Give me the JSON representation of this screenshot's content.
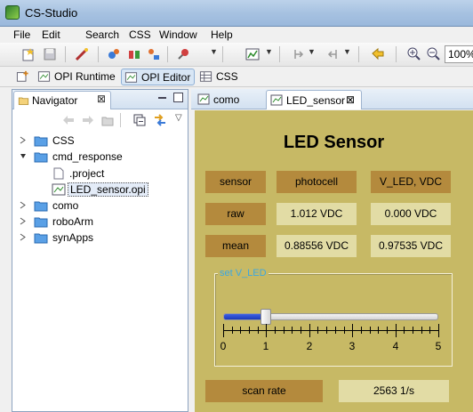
{
  "window": {
    "title": "CS-Studio"
  },
  "menu": [
    "File",
    "Edit",
    "Search",
    "CSS",
    "Window",
    "Help"
  ],
  "toolbar": {
    "zoom": "100%"
  },
  "perspectives": {
    "runtime": "OPI Runtime",
    "editor": "OPI Editor",
    "css": "CSS"
  },
  "navigator": {
    "tab_label": "Navigator",
    "close_glyph": "⊠",
    "tree": [
      {
        "label": "CSS",
        "type": "folder",
        "expanded": false,
        "depth": 0
      },
      {
        "label": "cmd_response",
        "type": "folder",
        "expanded": true,
        "depth": 0
      },
      {
        "label": ".project",
        "type": "file",
        "depth": 1
      },
      {
        "label": "LED_sensor.opi",
        "type": "opi",
        "depth": 1,
        "selected": true
      },
      {
        "label": "como",
        "type": "folder",
        "expanded": false,
        "depth": 0
      },
      {
        "label": "roboArm",
        "type": "folder",
        "expanded": false,
        "depth": 0
      },
      {
        "label": "synApps",
        "type": "folder",
        "expanded": false,
        "depth": 0
      }
    ]
  },
  "editor": {
    "tabs": [
      {
        "label": "como",
        "active": false
      },
      {
        "label": "LED_sensor",
        "active": true,
        "close": "⊠"
      }
    ],
    "opi": {
      "title": "LED Sensor",
      "header": {
        "c1": "sensor",
        "c2": "photocell",
        "c3": "V_LED, VDC"
      },
      "raw": {
        "label": "raw",
        "photocell": "1.012 VDC",
        "vled": "0.000 VDC"
      },
      "mean": {
        "label": "mean",
        "photocell": "0.88556 VDC",
        "vled": "0.97535 VDC"
      },
      "slider": {
        "group_title": "set V_LED",
        "value": 1.0,
        "min": 0,
        "max": 5,
        "tick_labels": [
          "0",
          "1",
          "2",
          "3",
          "4",
          "5"
        ]
      },
      "scan": {
        "label": "scan rate",
        "value": "2563 1/s"
      }
    }
  },
  "colors": {
    "canvas": "#c7b965",
    "label_box": "#b48a3d",
    "value_box": "#e2dca5",
    "slider_fill": "#2a4fd6",
    "group_title": "#3da7e0"
  }
}
